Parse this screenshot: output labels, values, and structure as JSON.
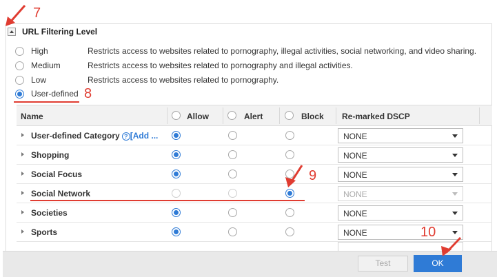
{
  "section": {
    "title": "URL Filtering Level"
  },
  "levels": [
    {
      "label": "High",
      "desc": "Restricts access to websites related to pornography, illegal activities, social networking, and video sharing.",
      "selected": false
    },
    {
      "label": "Medium",
      "desc": "Restricts access to websites related to pornography and illegal activities.",
      "selected": false
    },
    {
      "label": "Low",
      "desc": "Restricts access to websites related to pornography.",
      "selected": false
    },
    {
      "label": "User-defined",
      "desc": "",
      "selected": true
    }
  ],
  "table": {
    "headers": {
      "name": "Name",
      "allow": "Allow",
      "alert": "Alert",
      "block": "Block",
      "dscp": "Re-marked DSCP"
    },
    "rows": [
      {
        "name": "User-defined Category",
        "add_link": "[Add ...",
        "action": "allow",
        "dscp": "NONE"
      },
      {
        "name": "Shopping",
        "action": "allow",
        "dscp": "NONE"
      },
      {
        "name": "Social Focus",
        "action": "allow",
        "dscp": "NONE"
      },
      {
        "name": "Social Network",
        "action": "block",
        "dscp": "NONE"
      },
      {
        "name": "Societies",
        "action": "allow",
        "dscp": "NONE"
      },
      {
        "name": "Sports",
        "action": "allow",
        "dscp": "NONE"
      }
    ]
  },
  "footer": {
    "test_label": "Test",
    "ok_label": "OK"
  },
  "annotations": {
    "step7": "7",
    "step8": "8",
    "step9": "9",
    "step10": "10"
  },
  "colors": {
    "accent": "#2f7bd6",
    "annotation": "#e03c31"
  }
}
